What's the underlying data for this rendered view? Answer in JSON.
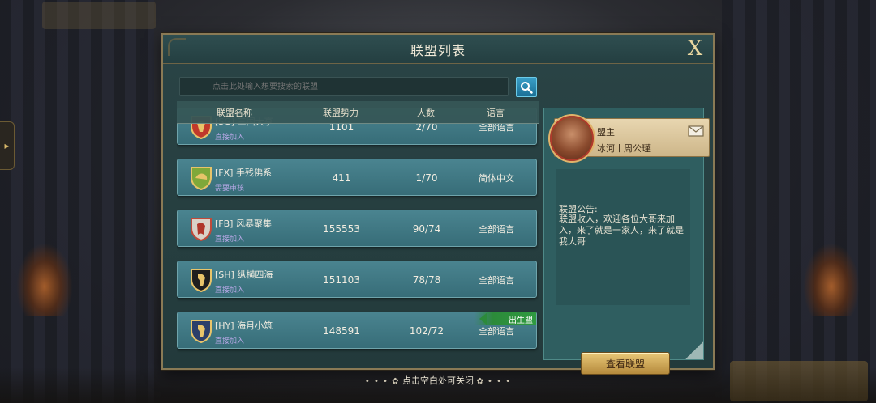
{
  "dialog": {
    "title": "联盟列表",
    "close_label": "X",
    "close_hint": "点击空白处可关闭",
    "hint_ornament_left": "• • • ✿",
    "hint_ornament_right": "✿ • • •"
  },
  "search": {
    "placeholder": "点击此处输入想要搜索的联盟"
  },
  "list": {
    "headers": [
      "联盟名称",
      "联盟势力",
      "人数",
      "语言"
    ],
    "rows": [
      {
        "name": "[SG] 三国大亨",
        "join": "直接加入",
        "power": "1101",
        "members": "2/70",
        "language": "全部语言",
        "emblem_color": "#c0392b",
        "emblem": "shield-red-icon"
      },
      {
        "name": "[FX] 手残佛系",
        "join": "需要审核",
        "power": "411",
        "members": "1/70",
        "language": "简体中文",
        "emblem_color": "#7fa83a",
        "emblem": "shield-green-icon"
      },
      {
        "name": "[FB] 风暴聚集",
        "join": "直接加入",
        "power": "155553",
        "members": "90/74",
        "language": "全部语言",
        "emblem_color": "#d9d2c8",
        "emblem": "shield-white-icon"
      },
      {
        "name": "[SH] 纵横四海",
        "join": "直接加入",
        "power": "151103",
        "members": "78/78",
        "language": "全部语言",
        "emblem_color": "#1e1e1e",
        "emblem": "shield-black-icon"
      },
      {
        "name": "[HY] 海月小筑",
        "join": "直接加入",
        "power": "148591",
        "members": "102/72",
        "language": "全部语言",
        "emblem_color": "#2c3e6a",
        "emblem": "shield-blue-icon",
        "badge": "出生盟"
      }
    ]
  },
  "info": {
    "leader_role": "盟主",
    "leader_name": "冰河丨周公瑾",
    "notice_title": "联盟公告:",
    "notice_text": "联盟收人，欢迎各位大哥来加入，来了就是一家人，来了就是我大哥",
    "view_button": "查看联盟"
  },
  "colors": {
    "panel": "#2a4446",
    "row": "#4a8490",
    "accent_gold": "#e9c877",
    "badge_green": "#2f9a40",
    "join_purple": "#b7a8e6"
  }
}
